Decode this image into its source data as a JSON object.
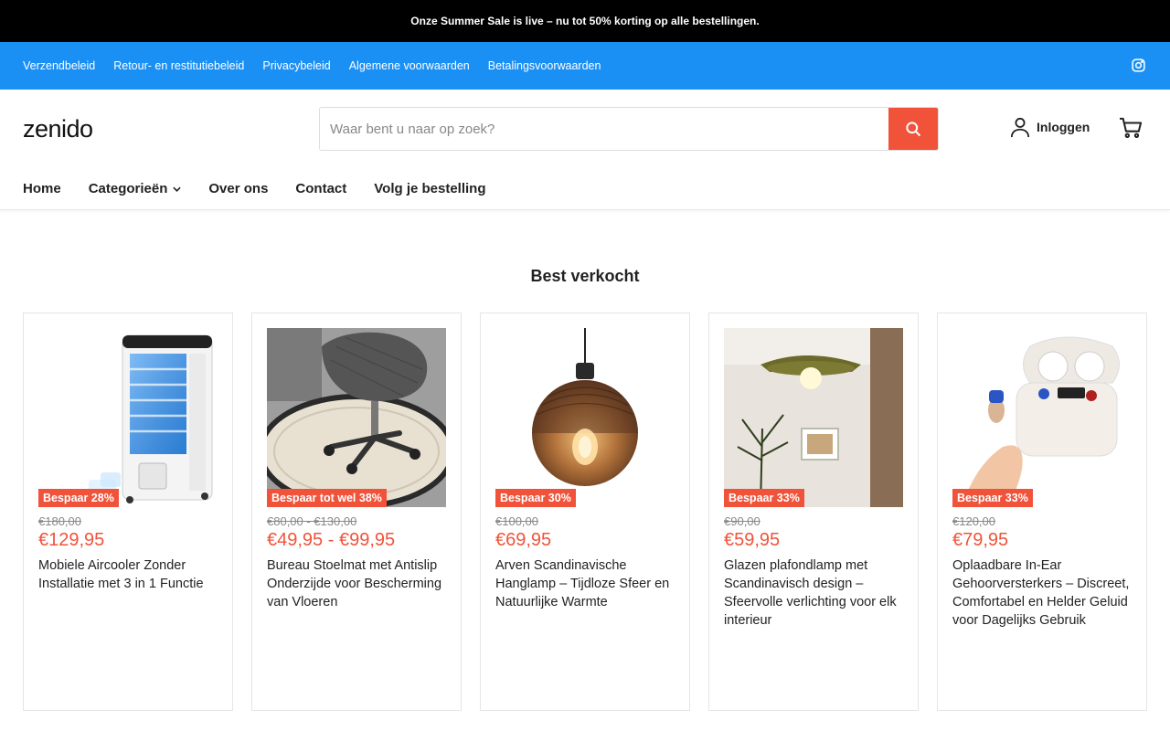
{
  "announcement": "Onze Summer Sale is live – nu tot 50% korting op alle bestellingen.",
  "topnav": {
    "links": [
      "Verzendbeleid",
      "Retour- en restitutiebeleid",
      "Privacybeleid",
      "Algemene voorwaarden",
      "Betalingsvoorwaarden"
    ],
    "social_icon": "instagram-icon"
  },
  "header": {
    "logo": "zenido",
    "search_placeholder": "Waar bent u naar op zoek?",
    "login_label": "Inloggen"
  },
  "mainnav": {
    "items": [
      "Home",
      "Categorieën",
      "Over ons",
      "Contact",
      "Volg je bestelling"
    ]
  },
  "section": {
    "title": "Best verkocht"
  },
  "products": [
    {
      "badge": "Bespaar 28%",
      "old_price": "€180,00",
      "price": "€129,95",
      "title": "Mobiele Aircooler Zonder Installatie met 3 in 1 Functie"
    },
    {
      "badge": "Bespaar tot wel 38%",
      "old_price": "€80,00 - €130,00",
      "price": "€49,95 - €99,95",
      "title": "Bureau Stoelmat met Antislip Onderzijde voor Bescherming van Vloeren"
    },
    {
      "badge": "Bespaar 30%",
      "old_price": "€100,00",
      "price": "€69,95",
      "title": "Arven Scandinavische Hanglamp – Tijdloze Sfeer en Natuurlijke Warmte"
    },
    {
      "badge": "Bespaar 33%",
      "old_price": "€90,00",
      "price": "€59,95",
      "title": "Glazen plafondlamp met Scandinavisch design – Sfeervolle verlichting voor elk interieur"
    },
    {
      "badge": "Bespaar 33%",
      "old_price": "€120,00",
      "price": "€79,95",
      "title": "Oplaadbare In-Ear Gehoorversterkers – Discreet, Comfortabel en Helder Geluid voor Dagelijks Gebruik"
    }
  ],
  "colors": {
    "accent": "#f0533a",
    "topnav_bg": "#1a90f5",
    "announce_bg": "#000000"
  }
}
